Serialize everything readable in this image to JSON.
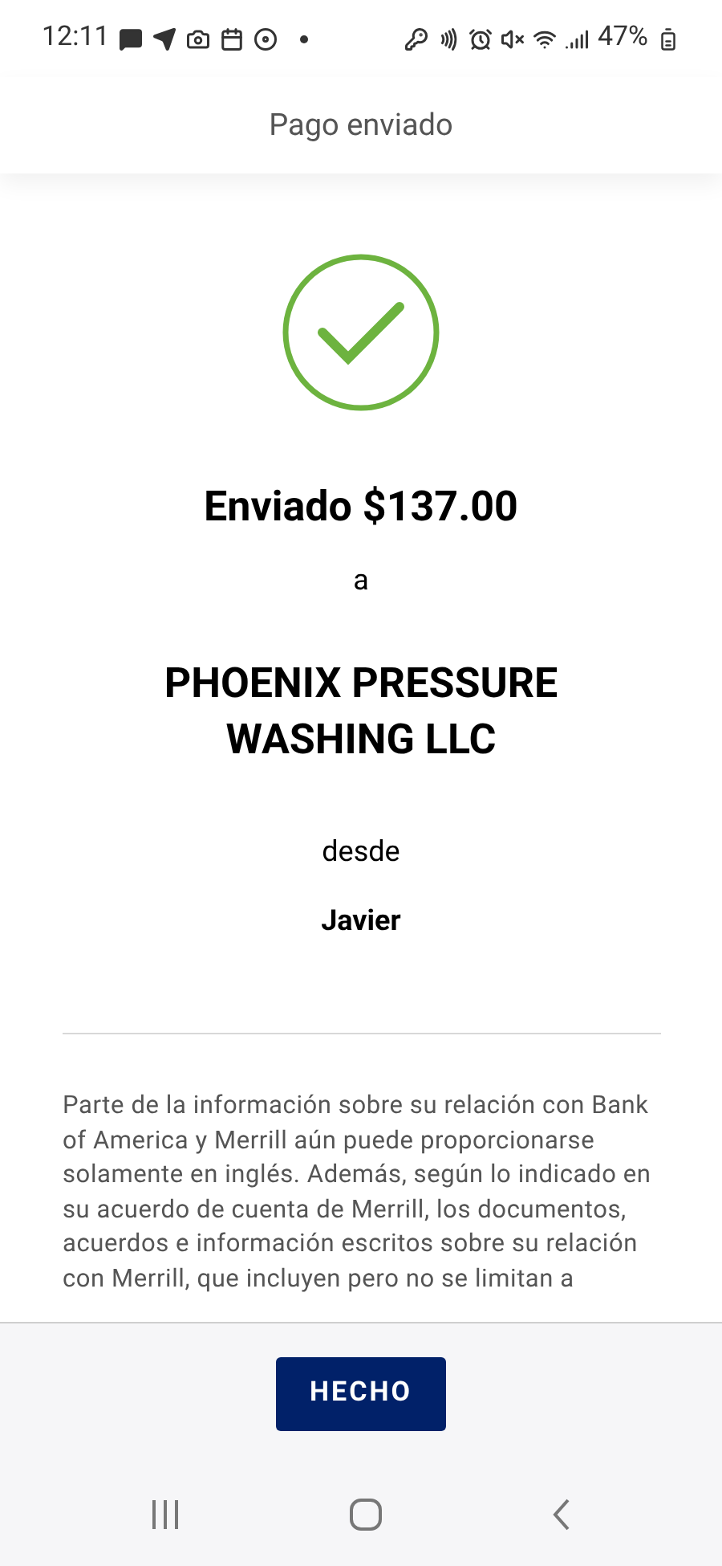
{
  "status_bar": {
    "time": "12:11",
    "battery": "47%"
  },
  "header": {
    "title": "Pago enviado"
  },
  "confirmation": {
    "amount_line": "Enviado $137.00",
    "to_word": "a",
    "recipient": "PHOENIX PRESSURE WASHING LLC",
    "from_word": "desde",
    "sender": "Javier"
  },
  "disclaimer": "Parte de la información sobre su relación con Bank of America y Merrill aún puede proporcionarse solamente en inglés. Además, según lo indicado en su acuerdo de cuenta de Merrill, los documentos, acuerdos e información escritos sobre su relación con Merrill, que incluyen pero no se limitan a",
  "footer": {
    "button": "HECHO"
  }
}
